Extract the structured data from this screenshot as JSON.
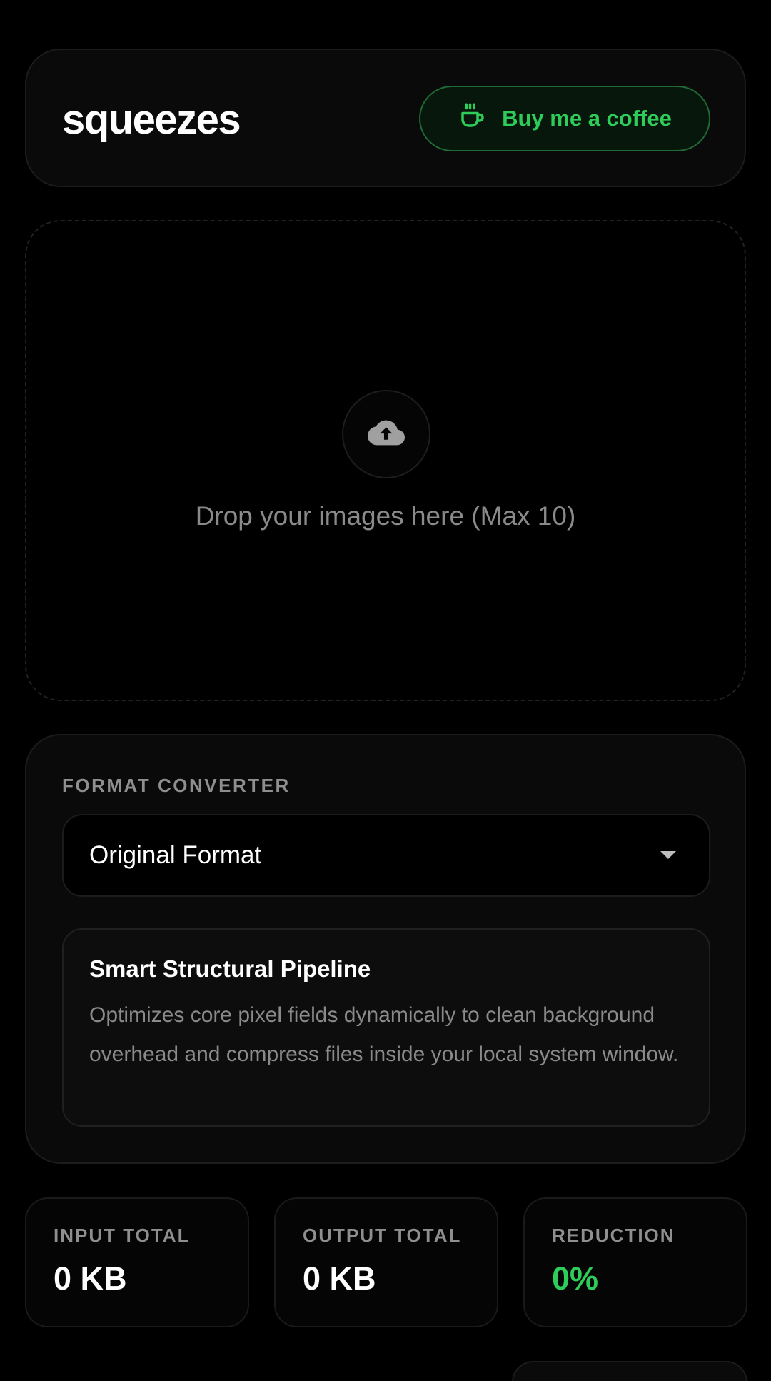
{
  "header": {
    "logo_text": "squeezes",
    "coffee_button_label": "Buy me a coffee",
    "coffee_icon": "coffee-cup-icon"
  },
  "dropzone": {
    "icon": "cloud-upload-icon",
    "text": "Drop your images here (Max 10)"
  },
  "format_converter": {
    "section_label": "FORMAT CONVERTER",
    "selected_format": "Original Format",
    "info_title": "Smart Structural Pipeline",
    "info_description": "Optimizes core pixel fields dynamically to clean background overhead and compress files inside your local system window."
  },
  "stats": {
    "input_total": {
      "label": "INPUT TOTAL",
      "value": "0 KB"
    },
    "output_total": {
      "label": "OUTPUT TOTAL",
      "value": "0 KB"
    },
    "reduction": {
      "label": "REDUCTION",
      "value": "0%"
    }
  },
  "colors": {
    "background": "#000000",
    "card": "#0a0a0a",
    "accent_green": "#2ecc59",
    "muted_text": "#8a8a8a"
  }
}
